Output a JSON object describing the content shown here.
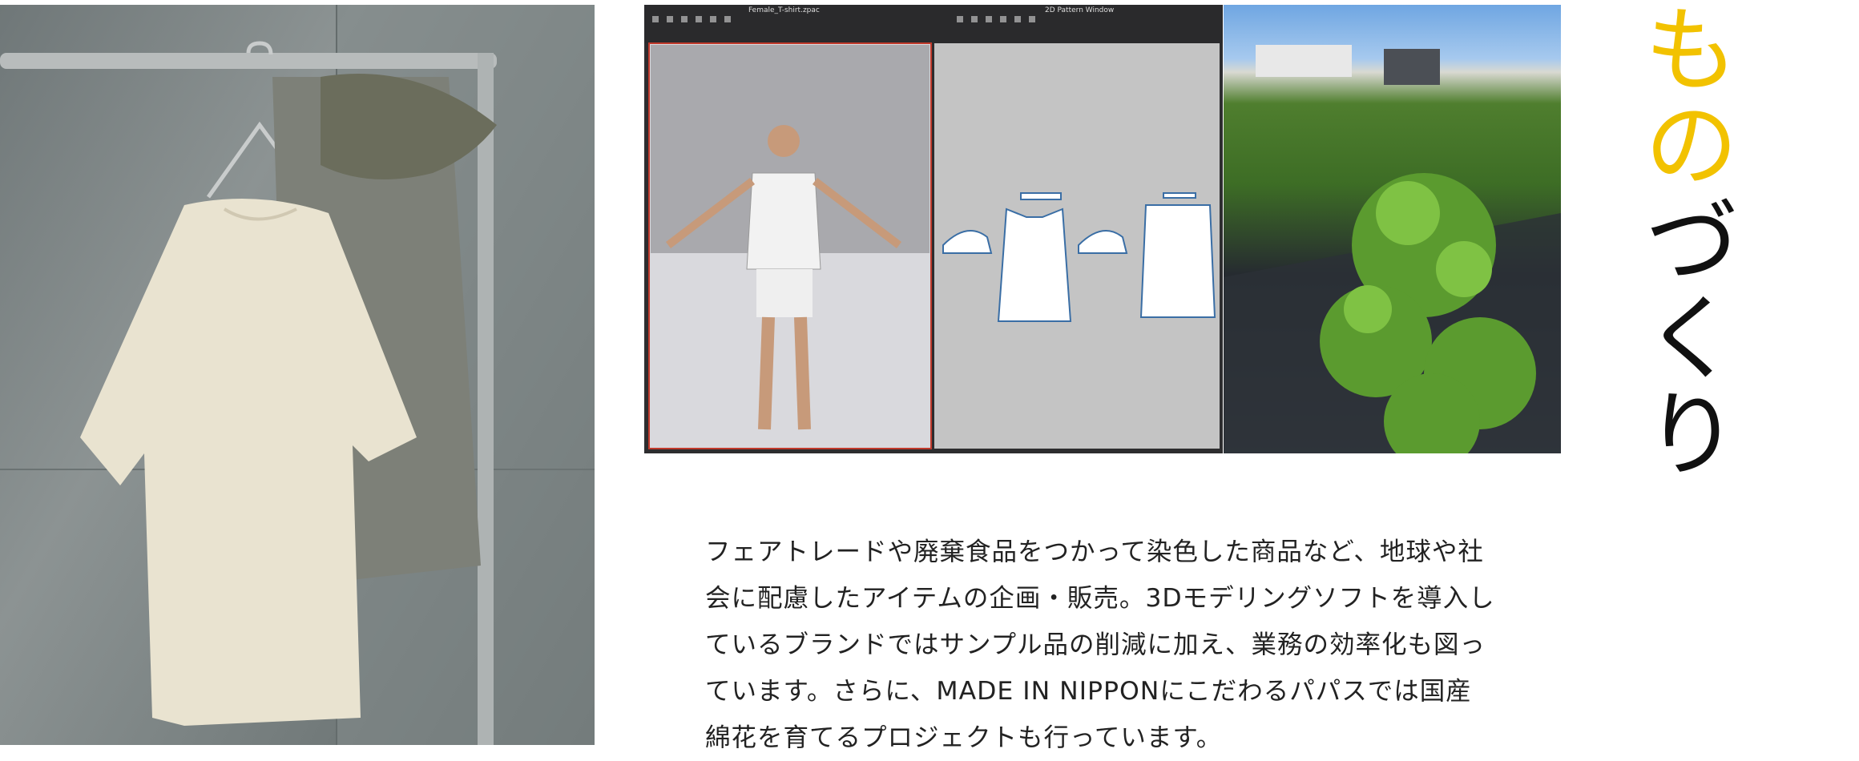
{
  "title": {
    "highlight": "もの",
    "rest": "づくり"
  },
  "software": {
    "left_window_title": "Female_T-shirt.zpac",
    "right_window_title": "2D Pattern Window"
  },
  "body_text": "フェアトレードや廃棄食品をつかって染色した商品など、地球や社\n会に配慮したアイテムの企画・販売。3Dモデリングソフトを導入し\nているブランドではサンプル品の削減に加え、業務の効率化も図っ\nています。さらに、MADE IN NIPPONにこだわるパパスでは国産\n綿花を育てるプロジェクトも行っています。",
  "colors": {
    "accent": "#f2c200",
    "text": "#222222"
  }
}
